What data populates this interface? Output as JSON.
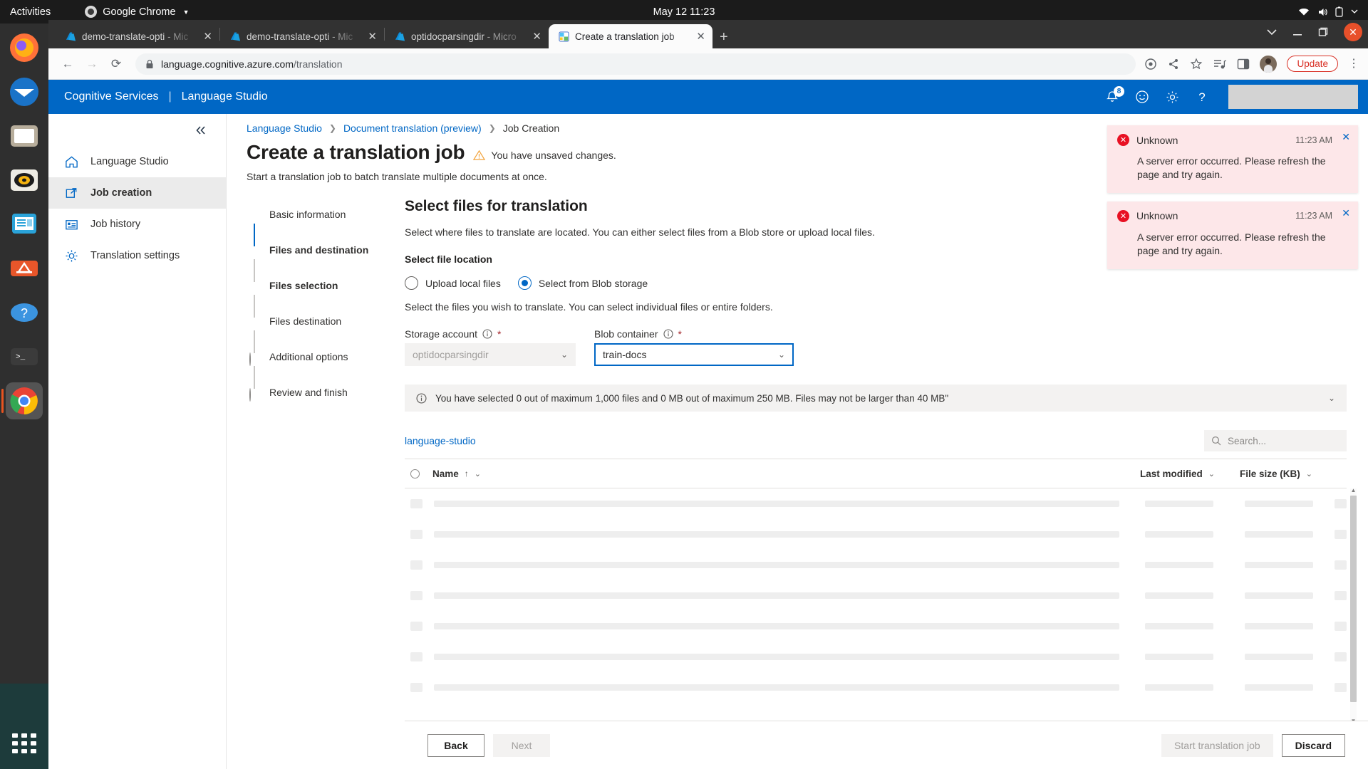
{
  "os": {
    "activities": "Activities",
    "app_name": "Google Chrome",
    "clock": "May 12  11:23"
  },
  "browser": {
    "tabs": [
      {
        "title": "demo-translate-opti",
        "suffix": " - Mic",
        "icon": "azure-icon",
        "active": false
      },
      {
        "title": "demo-translate-opti",
        "suffix": " - Mic",
        "icon": "azure-icon",
        "active": false
      },
      {
        "title": "optidocparsingdir",
        "suffix": " - Micro",
        "icon": "azure-icon",
        "active": false
      },
      {
        "title": "Create a translation job",
        "suffix": "",
        "icon": "translate-icon",
        "active": true
      }
    ],
    "url_host": "language.cognitive.azure.com",
    "url_path": "/translation",
    "update_label": "Update"
  },
  "app_header": {
    "product": "Cognitive Services",
    "separator": "|",
    "studio": "Language Studio",
    "notification_count": "8"
  },
  "sidebar": {
    "items": [
      {
        "label": "Language Studio",
        "icon": "home-icon",
        "selected": false
      },
      {
        "label": "Job creation",
        "icon": "job-creation-icon",
        "selected": true
      },
      {
        "label": "Job history",
        "icon": "job-history-icon",
        "selected": false
      },
      {
        "label": "Translation settings",
        "icon": "gear-icon",
        "selected": false
      }
    ]
  },
  "breadcrumb": {
    "items": [
      "Language Studio",
      "Document translation (preview)",
      "Job Creation"
    ]
  },
  "page": {
    "title": "Create a translation job",
    "unsaved_warning": "You have unsaved changes.",
    "subtitle": "Start a translation job to batch translate multiple documents at once."
  },
  "wizard": {
    "steps": [
      {
        "label": "Basic information",
        "state": "done",
        "bold": false
      },
      {
        "label": "Files and destination",
        "state": "active",
        "bold": true
      },
      {
        "label": "Files selection",
        "state": "substep-active",
        "bold": true
      },
      {
        "label": "Files destination",
        "state": "substep",
        "bold": false
      },
      {
        "label": "Additional options",
        "state": "pending",
        "bold": false
      },
      {
        "label": "Review and finish",
        "state": "pending",
        "bold": false
      }
    ]
  },
  "main": {
    "heading": "Select files for translation",
    "description": "Select where files to translate are located. You can either select files from a Blob store or upload local files.",
    "file_location_label": "Select file location",
    "radios": [
      {
        "label": "Upload local files",
        "selected": false
      },
      {
        "label": "Select from Blob storage",
        "selected": true
      }
    ],
    "radio_hint": "Select the files you wish to translate. You can select individual files or entire folders.",
    "storage_account": {
      "label": "Storage account",
      "required": "*",
      "value": "optidocparsingdir",
      "disabled": true
    },
    "blob_container": {
      "label": "Blob container",
      "required": "*",
      "value": "train-docs",
      "focused": true
    },
    "info_message": "You have selected 0 out of maximum 1,000 files and 0 MB out of maximum 250 MB. Files may not be larger than 40 MB\"",
    "blob_breadcrumb": "language-studio",
    "search_placeholder": "Search...",
    "table": {
      "columns": [
        "Name",
        "Last modified",
        "File size (KB)"
      ],
      "sort_indicator": "↑",
      "loading_rows": 7
    }
  },
  "footer": {
    "back": "Back",
    "next": "Next",
    "start": "Start translation job",
    "discard": "Discard"
  },
  "toasts": [
    {
      "title": "Unknown",
      "time": "11:23 AM",
      "message": "A server error occurred. Please refresh the page and try again."
    },
    {
      "title": "Unknown",
      "time": "11:23 AM",
      "message": "A server error occurred. Please refresh the page and try again."
    }
  ],
  "colors": {
    "azure_blue": "#0067c5",
    "error_bg": "#fde7e9",
    "error_red": "#e81123",
    "update_red": "#d93025"
  }
}
